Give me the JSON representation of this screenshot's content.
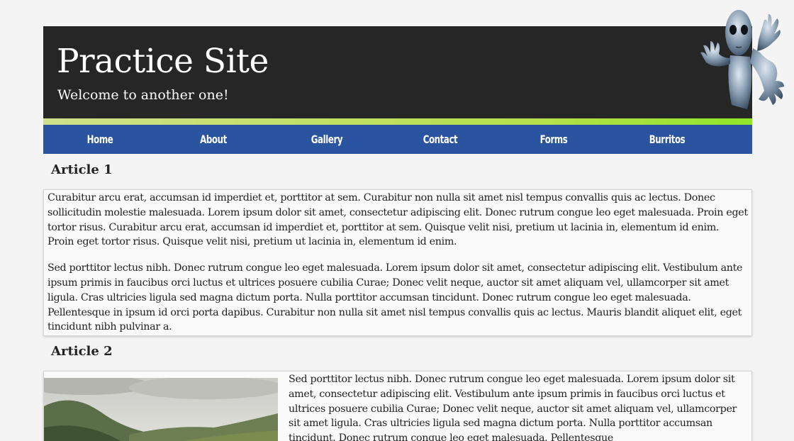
{
  "header": {
    "title": "Practice Site",
    "subtitle": "Welcome to another one!",
    "background_color": "#262626",
    "mascot_icon": "alien-mascot"
  },
  "nav": {
    "items": [
      {
        "label": "Home"
      },
      {
        "label": "About"
      },
      {
        "label": "Gallery"
      },
      {
        "label": "Contact"
      },
      {
        "label": "Forms"
      },
      {
        "label": "Burritos"
      }
    ],
    "background_color": "#2a53a0"
  },
  "articles": [
    {
      "heading": "Article 1",
      "paragraphs": [
        "Curabitur arcu erat, accumsan id imperdiet et, porttitor at sem. Curabitur non nulla sit amet nisl tempus convallis quis ac lectus. Donec sollicitudin molestie malesuada. Lorem ipsum dolor sit amet, consectetur adipiscing elit. Donec rutrum congue leo eget malesuada. Proin eget tortor risus. Curabitur arcu erat, accumsan id imperdiet et, porttitor at sem. Quisque velit nisi, pretium ut lacinia in, elementum id enim. Proin eget tortor risus. Quisque velit nisi, pretium ut lacinia in, elementum id enim.",
        "Sed porttitor lectus nibh. Donec rutrum congue leo eget malesuada. Lorem ipsum dolor sit amet, consectetur adipiscing elit. Vestibulum ante ipsum primis in faucibus orci luctus et ultrices posuere cubilia Curae; Donec velit neque, auctor sit amet aliquam vel, ullamcorper sit amet ligula. Cras ultricies ligula sed magna dictum porta. Nulla porttitor accumsan tincidunt. Donec rutrum congue leo eget malesuada. Pellentesque in ipsum id orci porta dapibus. Curabitur non nulla sit amet nisl tempus convallis quis ac lectus. Mauris blandit aliquet elit, eget tincidunt nibh pulvinar a."
      ]
    },
    {
      "heading": "Article 2",
      "image_icon": "mountain-landscape-photo",
      "paragraphs": [
        "Sed porttitor lectus nibh. Donec rutrum congue leo eget malesuada. Lorem ipsum dolor sit amet, consectetur adipiscing elit. Vestibulum ante ipsum primis in faucibus orci luctus et ultrices posuere cubilia Curae; Donec velit neque, auctor sit amet aliquam vel, ullamcorper sit amet ligula. Cras ultricies ligula sed magna dictum porta. Nulla porttitor accumsan tincidunt. Donec rutrum congue leo eget malesuada. Pellentesque"
      ]
    }
  ]
}
